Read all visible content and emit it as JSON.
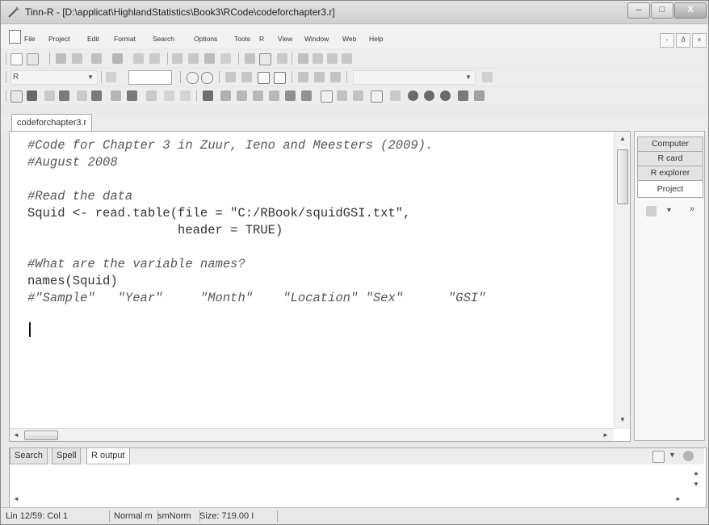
{
  "window": {
    "title": "Tinn-R - [D:\\applicat\\HighlandStatistics\\Book3\\RCode\\codeforchapter3.r]",
    "controls": {
      "minimize": "–",
      "maximize": "□",
      "close": "X"
    }
  },
  "menubar": {
    "items": [
      "File",
      "Project",
      "Edit",
      "Format",
      "Search",
      "Options",
      "Tools",
      "R",
      "View",
      "Window",
      "Web",
      "Help"
    ],
    "mdi_controls": [
      "-",
      "ð",
      "×"
    ]
  },
  "toolbar": {
    "syntax_combo": "R",
    "extra_combo": "",
    "wide_combo": ""
  },
  "editor": {
    "tab_label": "codeforchapter3.r",
    "lines": [
      {
        "text": "#Code for Chapter 3 in Zuur, Ieno and Meesters (2009).",
        "comment": true
      },
      {
        "text": "#August 2008",
        "comment": true
      },
      {
        "text": "",
        "comment": false
      },
      {
        "text": "#Read the data",
        "comment": true
      },
      {
        "text": "Squid <- read.table(file = \"C:/RBook/squidGSI.txt\",",
        "comment": false
      },
      {
        "text": "                    header = TRUE)",
        "comment": false
      },
      {
        "text": "",
        "comment": false
      },
      {
        "text": "#What are the variable names?",
        "comment": true
      },
      {
        "text": "names(Squid)",
        "comment": false
      },
      {
        "text": "#\"Sample\"   \"Year\"     \"Month\"    \"Location\" \"Sex\"      \"GSI\"",
        "comment": true
      }
    ]
  },
  "right_panel": {
    "tabs": [
      "Computer",
      "R card",
      "R explorer",
      "Project"
    ],
    "active_tab": "Project",
    "more_glyph": "»"
  },
  "bottom_panel": {
    "tabs": [
      "Search",
      "Spell",
      "R output"
    ],
    "active_tab": "R output"
  },
  "status": {
    "position": "Lin 12/59: Col 1",
    "mode": "Normal m",
    "mode2": "smNorm",
    "size": "Size: 719.00 I"
  },
  "colors": {
    "chrome": "#e9e9e9",
    "editor_bg": "#ffffff",
    "comment": "#555555",
    "code": "#333333"
  }
}
